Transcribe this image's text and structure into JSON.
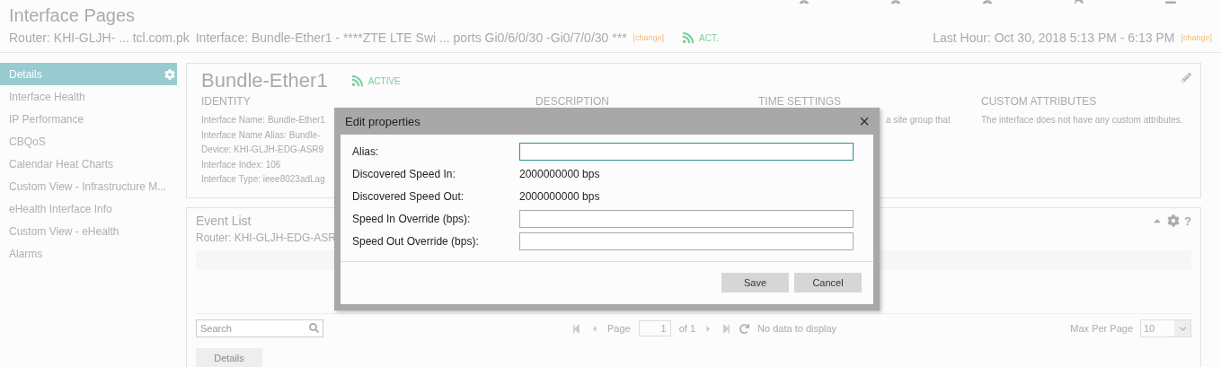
{
  "header": {
    "title": "Interface Pages",
    "router": "Router: KHI-GLJH- ... tcl.com.pk",
    "interface": "Interface: Bundle-Ether1 - ****ZTE LTE Swi ... ports Gi0/6/0/30 -Gi0/7/0/30 ***",
    "change_link": "[change]",
    "status": "ACT.",
    "time_range": "Last Hour: Oct 30, 2018 5:13 PM - 6:13 PM",
    "time_change_link": "[change]"
  },
  "sidebar": {
    "items": [
      {
        "label": "Details",
        "selected": true
      },
      {
        "label": "Interface Health",
        "selected": false
      },
      {
        "label": "IP Performance",
        "selected": false
      },
      {
        "label": "CBQoS",
        "selected": false
      },
      {
        "label": "Calendar Heat Charts",
        "selected": false
      },
      {
        "label": "Custom View - Infrastructure M...",
        "selected": false
      },
      {
        "label": "eHealth Interface Info",
        "selected": false
      },
      {
        "label": "Custom View - eHealth",
        "selected": false
      },
      {
        "label": "Alarms",
        "selected": false
      }
    ]
  },
  "details": {
    "title": "Bundle-Ether1",
    "status": "ACTIVE",
    "columns": [
      {
        "heading": "IDENTITY",
        "lines": [
          "Interface Name: Bundle-Ether1",
          "Interface Name Alias: Bundle-",
          "Device: KHI-GLJH-EDG-ASR9",
          "Interface Index: 106",
          "Interface Type: ieee8023adLag"
        ]
      },
      {
        "heading": "DESCRIPTION"
      },
      {
        "heading": "TIME SETTINGS",
        "lines": [
          "a site group that"
        ]
      },
      {
        "heading": "CUSTOM ATTRIBUTES",
        "lines": [
          "The interface does not have any custom attributes."
        ]
      }
    ]
  },
  "event_list": {
    "title": "Event List",
    "help": "?",
    "router": "Router: KHI-GLJH-EDG-ASR",
    "search_placeholder": "Search",
    "page_label": "Page",
    "page": "1",
    "of": "of 1",
    "no_data": "No data to display",
    "max_per_page_label": "Max Per Page",
    "max_per_page": "10",
    "details_button": "Details"
  },
  "dialog": {
    "title": "Edit properties",
    "close": "×",
    "fields": [
      {
        "label": "Alias:",
        "kind": "input",
        "focused": true
      },
      {
        "label": "Discovered Speed In:",
        "kind": "text",
        "value": "2000000000 bps"
      },
      {
        "label": "Discovered Speed Out:",
        "kind": "text",
        "value": "2000000000 bps"
      },
      {
        "label": "Speed In Override (bps):",
        "kind": "input",
        "focused": false
      },
      {
        "label": "Speed Out Override (bps):",
        "kind": "input",
        "focused": false
      }
    ],
    "buttons": [
      "Save",
      "Cancel"
    ]
  }
}
